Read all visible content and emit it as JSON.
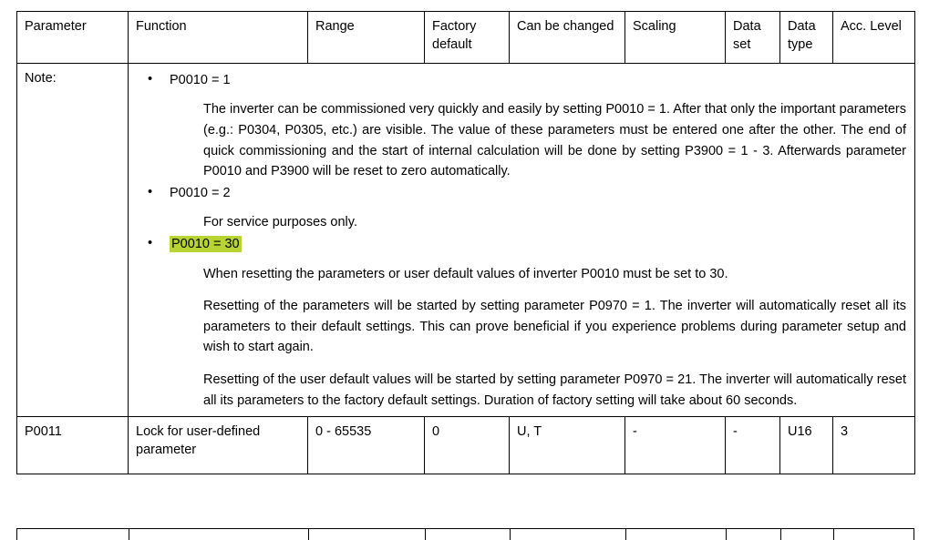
{
  "table": {
    "headers": [
      "Parameter",
      "Function",
      "Range",
      "Factory default",
      "Can be changed",
      "Scaling",
      "Data set",
      "Data type",
      "Acc. Level"
    ],
    "note_row": {
      "label": "Note:",
      "bullets": [
        {
          "heading": "P0010 = 1",
          "highlighted": false,
          "paragraphs": [
            "The inverter can be commissioned very quickly and easily by setting P0010 = 1. After that only the important parameters (e.g.: P0304, P0305, etc.) are visible. The value of these parameters must be entered one after the other. The end of quick commissioning and the start of internal calculation will be done by setting P3900 = 1 - 3. Afterwards parameter P0010 and P3900 will be reset to zero automatically."
          ]
        },
        {
          "heading": "P0010 = 2",
          "highlighted": false,
          "paragraphs": [
            "For service purposes only."
          ]
        },
        {
          "heading": "P0010 = 30",
          "highlighted": true,
          "paragraphs": [
            "When resetting the parameters or user default values of inverter P0010 must be set to 30.",
            "Resetting of the parameters will be started by setting parameter P0970 = 1. The inverter will automatically reset all its parameters to their default settings. This can prove beneficial if you experience problems during parameter setup and wish to start again.",
            "Resetting of the user default values will be started by setting parameter P0970 = 21. The inverter will automatically reset all its parameters to the factory default settings. Duration of factory setting will take about 60 seconds."
          ]
        }
      ]
    },
    "rows": [
      {
        "parameter": "P0011",
        "function": "Lock for user-defined parameter",
        "range": "0 - 65535",
        "factory_default": "0",
        "can_be_changed": "U, T",
        "scaling": "-",
        "data_set": "-",
        "data_type": "U16",
        "acc_level": "3"
      }
    ]
  },
  "colors": {
    "highlight": "#b8d433",
    "border": "#000000",
    "text": "#000000",
    "background": "#ffffff"
  }
}
